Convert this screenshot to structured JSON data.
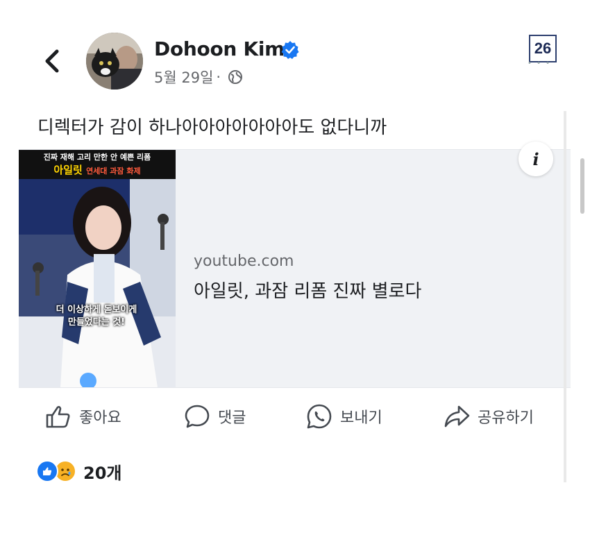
{
  "header": {
    "author_name": "Dohoon Kim",
    "date": "5월 29일",
    "separator": "·",
    "page_badge": "26"
  },
  "post": {
    "text": "디렉터가 감이 하나아아아아아아아도 없다니까"
  },
  "link_card": {
    "domain": "youtube.com",
    "title": "아일릿, 과잠 리폼 진짜 별로다",
    "thumbnail": {
      "line1": "진짜 재해 고리 만한 안 예쁜 리폼",
      "line2_main": "아일릿",
      "line2_sub": "연세대 과잠 화제",
      "caption": "더 이상하게 돋보이게 만들었다는 것!"
    },
    "info_label": "i"
  },
  "actions": {
    "like": "좋아요",
    "comment": "댓글",
    "send": "보내기",
    "share": "공유하기"
  },
  "reactions": {
    "count": "20개"
  },
  "colors": {
    "like_blue": "#1877f2",
    "sad_yellow": "#f7b125",
    "card_bg": "#f0f2f5"
  },
  "icons": [
    "back-icon",
    "verified-icon",
    "globe-icon",
    "info-icon",
    "thumbs-up-icon",
    "comment-icon",
    "whatsapp-icon",
    "share-icon",
    "like-reaction-icon",
    "sad-reaction-icon"
  ]
}
